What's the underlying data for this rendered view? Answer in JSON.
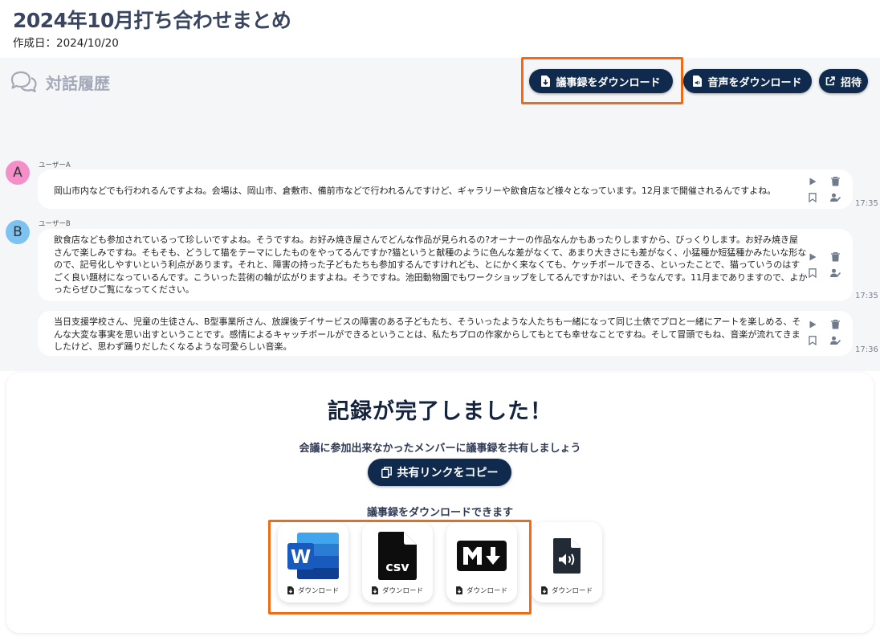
{
  "page": {
    "title": "2024年10月打ち合わせまとめ",
    "created": "作成日：2024/10/20"
  },
  "history": {
    "title": "対話履歴",
    "icon": "chat-bubbles-icon",
    "download_minutes_label": "議事録をダウンロード",
    "download_audio_label": "音声をダウンロード",
    "invite_label": "招待"
  },
  "messages": [
    {
      "user": "ユーザーA",
      "avatar": "A",
      "avatar_color": "#f48fca",
      "lines": [
        "岡山市内などでも行われるんですよね。会場は、岡山市、倉敷市、備前市などで行われるんですけど、ギャラリーや飲食店など様々となっています。12月まで開催されるんですよね。"
      ],
      "time": "17:35"
    },
    {
      "user": "ユーザーB",
      "avatar": "B",
      "avatar_color": "#7cc3f2",
      "lines": [
        "飲食店なども参加されているって珍しいですよね。そうですね。お好み焼き屋さんでどんな作品が見られるの?オーナーの作品なんかもあったりしますから、びっくりします。お好み焼き屋",
        "さんで楽しみですね。そもそも、どうして猫をテーマにしたものをやってるんですか?猫というと献種のように色んな差がなくて、あまり大きさにも差がなく、小猛種か短猛種かみたいな形な",
        "ので、記号化しやすいという利点があります。それと、障害の持った子どもたちも参加するんですけれども、とにかく来なくても、ケッチボールできる、といったことで、猫っていうのはす",
        "ごく良い題材になっているんです。こういった芸術の輪が広がりますよね。そうですね。池田動物園でもワークショップをしてるんですか?はい、そうなんです。11月までありますので、よか",
        "ったらぜひご覧になってください。"
      ],
      "time": "17:35"
    },
    {
      "user": "",
      "lines": [
        "当日支援学校さん、児童の生徒さん、B型事業所さん、放課後デイサービスの障害のある子どもたち、そういったような人たちも一緒になって同じ土俵でプロと一緒にアートを楽しめる、そ",
        "んな大変な事実を思い出すということです。感情によるキャッチボールができるということは、私たちプロの作家からしてもとても幸せなことですね。そして冒頭でもね、音楽が流れてきま",
        "したけど、思わず踊りだしたくなるような可愛らしい音楽。"
      ],
      "time": "17:36"
    }
  ],
  "message_actions": [
    "play-icon",
    "trash-icon",
    "bookmark-icon",
    "assign-speaker-icon"
  ],
  "completion": {
    "title": "記録が完了しました！",
    "share_text": "会議に参加出来なかったメンバーに議事録を共有しましょう",
    "copy_link_label": "共有リンクをコピー",
    "download_text": "議事録をダウンロードできます",
    "downloads": [
      {
        "format": "word-icon",
        "label": "ダウンロード"
      },
      {
        "format": "csv-file-icon",
        "label": "ダウンロード"
      },
      {
        "format": "markdown-icon",
        "label": "ダウンロード"
      },
      {
        "format": "audio-file-icon",
        "label": "ダウンロード"
      }
    ]
  },
  "colors": {
    "primary": "#0f2a4d",
    "highlight": "#f26b14",
    "background": "#f5f6f8"
  }
}
